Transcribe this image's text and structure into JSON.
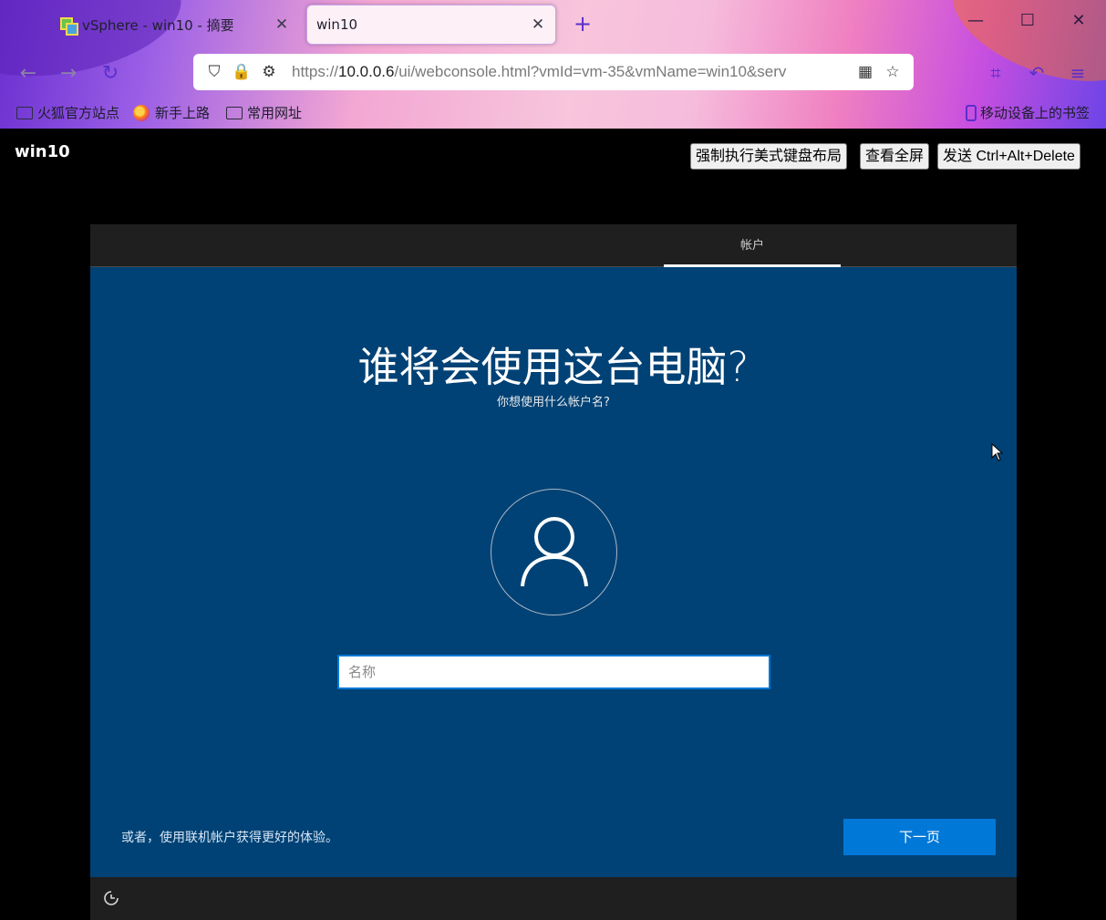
{
  "browser": {
    "tabs": [
      {
        "title": "vSphere - win10 - 摘要",
        "active": false
      },
      {
        "title": "win10",
        "active": true
      }
    ],
    "url": {
      "prefix": "https://",
      "host": "10.0.0.6",
      "path": "/ui/webconsole.html?vmId=vm-35&vmName=win10&serv"
    },
    "bookmarks": [
      "火狐官方站点",
      "新手上路",
      "常用网址"
    ],
    "mobile_bookmarks": "移动设备上的书签"
  },
  "console": {
    "vm_name": "win10",
    "buttons": [
      "强制执行美式键盘布局",
      "查看全屏",
      "发送 Ctrl+Alt+Delete"
    ]
  },
  "oobe": {
    "step_label": "帐户",
    "heading": "谁将会使用这台电脑?",
    "subheading": "你想使用什么帐户名?",
    "name_placeholder": "名称",
    "online_link": "或者，使用联机帐户获得更好的体验。",
    "next_button": "下一页",
    "colors": {
      "background": "#004275",
      "accent": "#0078d7",
      "bar": "#1f1f1f"
    }
  }
}
